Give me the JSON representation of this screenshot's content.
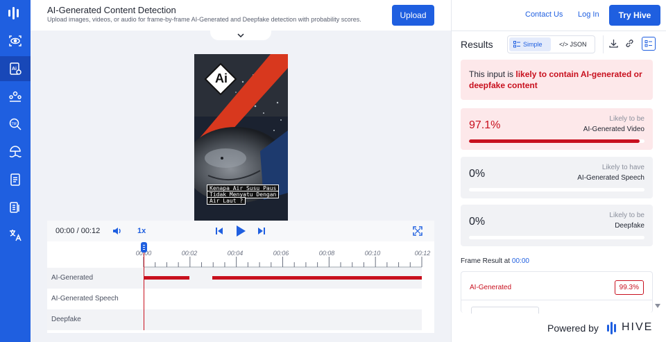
{
  "header": {
    "title": "AI-Generated Content Detection",
    "subtitle": "Upload images, videos, or audio for frame-by-frame AI-Generated and Deepfake detection with probability scores.",
    "upload_label": "Upload"
  },
  "media": {
    "badge_text": "Ai",
    "subtitle_lines": [
      "Kenapa Air Susu Paus",
      "Tidak Menyatu Dengan",
      "Air Laut ?"
    ]
  },
  "player": {
    "time": "00:00 / 00:12",
    "speed": "1x",
    "ticks": [
      "00:00",
      "00:02",
      "00:04",
      "00:06",
      "00:08",
      "00:10",
      "00:12"
    ],
    "tracks": [
      "AI-Generated",
      "AI-Generated Speech",
      "Deepfake"
    ],
    "ai_generated_segments": [
      [
        0,
        2
      ],
      [
        3,
        12
      ]
    ]
  },
  "topnav": {
    "contact": "Contact Us",
    "login": "Log In",
    "try": "Try Hive"
  },
  "results": {
    "title": "Results",
    "view_simple": "Simple",
    "view_json": "</> JSON",
    "verdict_prefix": "This input is ",
    "verdict_highlight": "likely to contain AI-generated or deepfake content",
    "cards": [
      {
        "pct": "97.1%",
        "likely": "Likely to be",
        "label": "AI-Generated Video",
        "value": 0.971
      },
      {
        "pct": "0%",
        "likely": "Likely to have",
        "label": "AI-Generated Speech",
        "value": 0
      },
      {
        "pct": "0%",
        "likely": "Likely to be",
        "label": "Deepfake",
        "value": 0
      }
    ],
    "frame_label": "Frame Result at ",
    "frame_time": "00:00",
    "frame_row_name": "AI-Generated",
    "frame_row_value": "99.3%"
  },
  "footer": {
    "powered": "Powered by",
    "brand": "HIVE"
  },
  "colors": {
    "primary": "#1f5fe0",
    "danger": "#c8101e"
  }
}
